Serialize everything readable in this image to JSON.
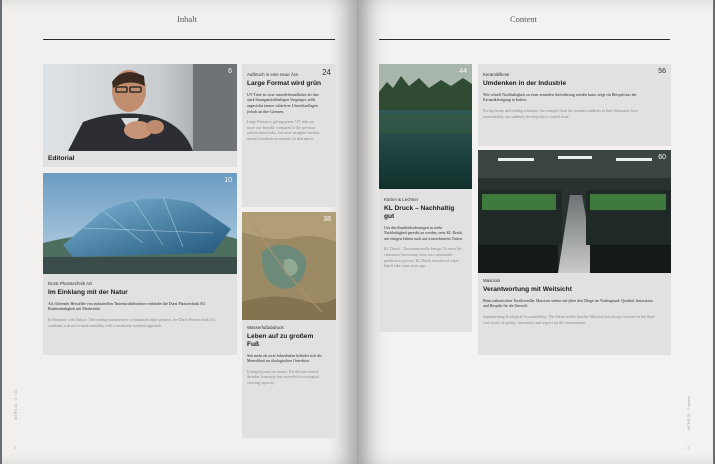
{
  "left_page": {
    "title": "Inhalt",
    "footer": "INTRO 01 · 2 / 14",
    "page_mark": "2"
  },
  "right_page": {
    "title": "Content",
    "footer": "INTRO 01 · Content",
    "page_mark": "3"
  },
  "articles": {
    "editorial": {
      "page": "6",
      "heading": "Editorial"
    },
    "durst": {
      "page": "10",
      "category": "Durst Phototechnik AG",
      "heading": "Im Einklang mit der Natur",
      "de": "Als führender Hersteller von industriellen Tintenstrahldruckern verbindet die Durst Phototechnik AG Bodenständigkeit mit Modernität.",
      "en": "In Harmony with Nature: The leading manufacturer of industrial inkjet printers, the Durst Phototechnik AG, combines a down-to-earth mentality with a modernity-oriented approach."
    },
    "format": {
      "page": "24",
      "category": "Aufbruch in eine neue Ära",
      "heading": "Large Format wird grün",
      "de": "UV-Tinte ist zwar umweltfreund­licher als ihre stark lösungsmittel­haltigen Vorgänger, stößt angesichts immer schärferer Umweltauflagen jedoch an ihre Grenzen.",
      "en": "Large Format is getting green: UV inks are more eco-friendly com­pared to the previous solvent-based inks, but more stringent environ­mental standards necessitate an al­ternative."
    },
    "wasser": {
      "page": "38",
      "category": "Wasserfußabdruck",
      "heading": "Leben auf zu großem Fuß",
      "de": "Seit mehr als zwei Jahrzehnten befindet sich die Menschheit im ökologischen Overshoot.",
      "en": "Living beyond our means: For the last several decades, humanity has exceeded its ecological carry­ing capacity."
    },
    "kl": {
      "page": "44",
      "category": "Kürten & Lechner",
      "heading": "KL Druck – Nachhaltig gut",
      "de": "Um den Kundenforderungen zu mehr Nachhaltigkeit gerecht zu werden, setzt KL Druck seit einigen Jahren auch auf wasser­basierte Tinten.",
      "en": "KL Druck – Environmentally benign: To meet the customers' increasing focus on a sustainable production process, KL Druck introduced water-based inks some years ago."
    },
    "keramik": {
      "page": "56",
      "category": "Keramikfliese",
      "heading": "Umdenken in der Industrie",
      "de": "Wie schnell Nachhaltigkeit zu einer zentralen Anforderung werden kann, zeigt ein Beispiel aus der Keramikfertigung in Italien.",
      "en": "Facing issues and finding solutions: An example from the ceramics industry in Italy illustrates, how sustainability can suddenly develop into a central issue."
    },
    "mascioni": {
      "page": "60",
      "category": "Mascioni",
      "heading": "Verantwortung mit Weitsicht",
      "de": "Beim italienischen Textilveredler Mascioni stehen seit jeher drei Dinge im Vordergrund: Qualität, Innovation und Respekt für die Umwelt.",
      "en": "Implementing Ecological Accountability: The Italian textile finisher Mascioni has always focused on the three core issues of quality, innovation and respect for the environment."
    }
  }
}
